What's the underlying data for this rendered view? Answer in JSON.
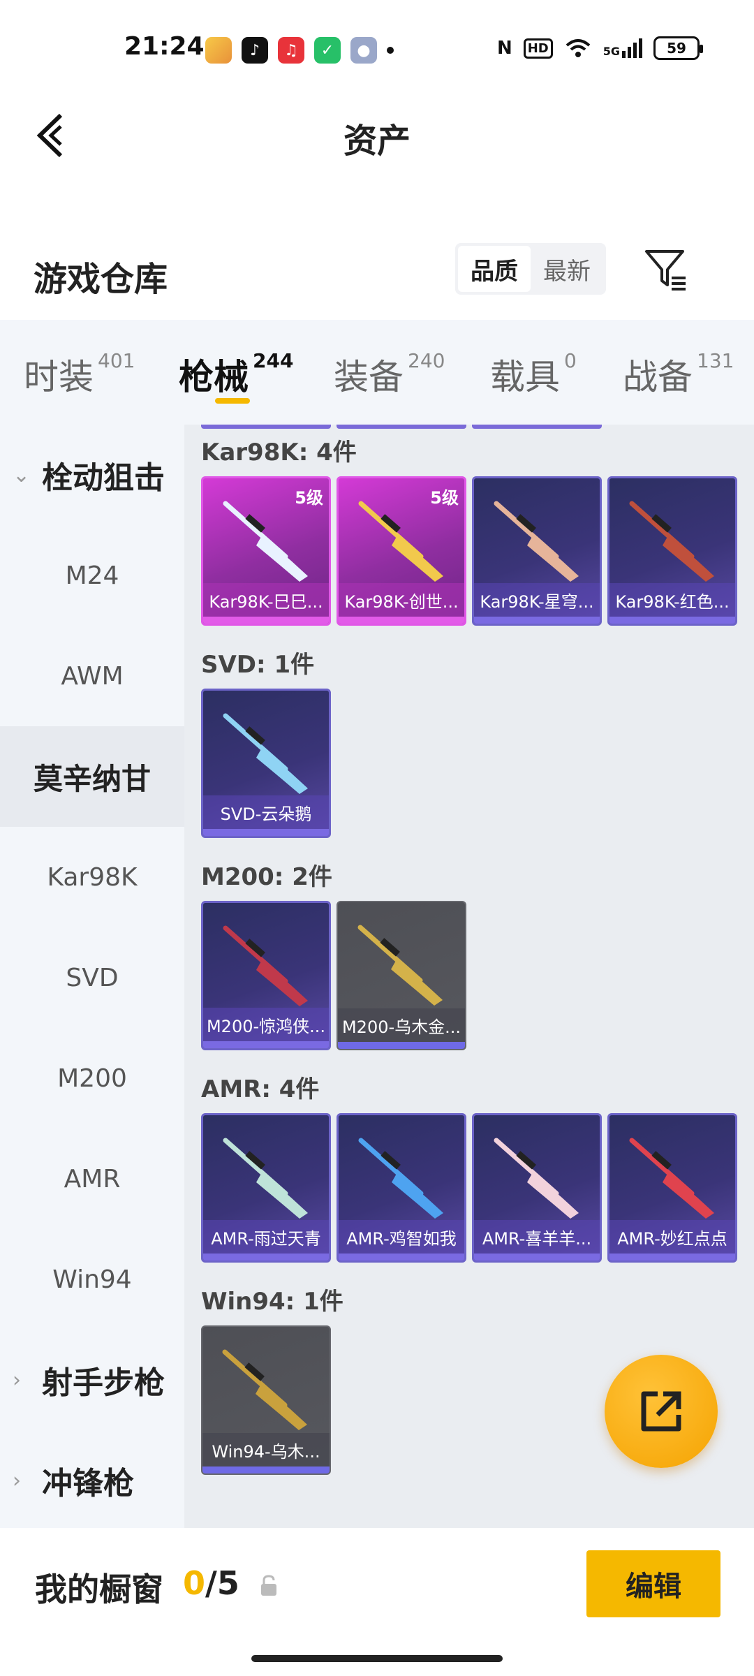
{
  "status_bar": {
    "time": "21:24",
    "app_icons": [
      "game-app-icon",
      "tiktok-icon",
      "music-icon",
      "security-icon",
      "cat-app-icon"
    ],
    "nfc": "N",
    "hd": "HD",
    "signal": "5G",
    "battery": "59"
  },
  "header": {
    "title": "资产",
    "back_icon": "chevron-left-icon"
  },
  "warehouse": {
    "title": "游戏仓库",
    "sort_options": [
      "品质",
      "最新"
    ],
    "sort_selected": "品质",
    "filter_icon": "filter-icon"
  },
  "category_tabs": [
    {
      "label": "时装",
      "count": "401"
    },
    {
      "label": "枪械",
      "count": "244",
      "active": true
    },
    {
      "label": "装备",
      "count": "240"
    },
    {
      "label": "载具",
      "count": "0"
    },
    {
      "label": "战备",
      "count": "131"
    }
  ],
  "sidebar": {
    "group_1": "栓动狙击",
    "items": [
      "M24",
      "AWM",
      "莫辛纳甘",
      "Kar98K",
      "SVD",
      "M200",
      "AMR",
      "Win94"
    ],
    "selected": "莫辛纳甘",
    "group_2": "射手步枪",
    "group_3": "冲锋枪"
  },
  "groups": [
    {
      "title": "Kar98K: 4件",
      "items": [
        {
          "name": "Kar98K-巳巳...",
          "level": "5级",
          "rarity": "legend",
          "accent": "#e9f2ff"
        },
        {
          "name": "Kar98K-创世...",
          "level": "5级",
          "rarity": "legend",
          "accent": "#f2c94c"
        },
        {
          "name": "Kar98K-星穹...",
          "rarity": "epic",
          "accent": "#e6b49a"
        },
        {
          "name": "Kar98K-红色...",
          "rarity": "epic",
          "accent": "#c0503c"
        }
      ]
    },
    {
      "title": "SVD: 1件",
      "items": [
        {
          "name": "SVD-云朵鹅",
          "rarity": "epic",
          "accent": "#8fd3f4"
        }
      ]
    },
    {
      "title": "M200: 2件",
      "items": [
        {
          "name": "M200-惊鸿侠...",
          "rarity": "epic",
          "accent": "#c0394b"
        },
        {
          "name": "M200-乌木金...",
          "rarity": "gray",
          "accent": "#d4b24a"
        }
      ]
    },
    {
      "title": "AMR: 4件",
      "items": [
        {
          "name": "AMR-雨过天青",
          "rarity": "epic",
          "accent": "#bfe3d9"
        },
        {
          "name": "AMR-鸡智如我",
          "rarity": "epic",
          "accent": "#4ea3f0"
        },
        {
          "name": "AMR-喜羊羊...",
          "rarity": "epic",
          "accent": "#f2d2dc"
        },
        {
          "name": "AMR-妙红点点",
          "rarity": "epic",
          "accent": "#e0434e"
        }
      ]
    },
    {
      "title": "Win94: 1件",
      "items": [
        {
          "name": "Win94-乌木...",
          "rarity": "gray",
          "accent": "#c9a13d"
        }
      ]
    }
  ],
  "fab": {
    "icon": "share-external-icon"
  },
  "showcase": {
    "label": "我的橱窗",
    "count_current": "0",
    "count_total": "/5",
    "lock_icon": "lock-icon",
    "edit_label": "编辑"
  }
}
